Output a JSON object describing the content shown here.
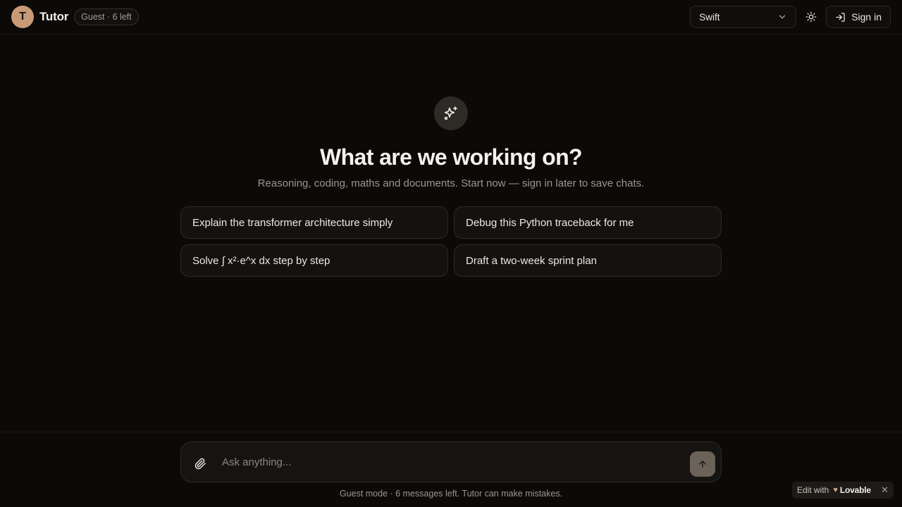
{
  "header": {
    "avatar_letter": "T",
    "app_name": "Tutor",
    "guest_badge": "Guest · 6 left",
    "model_selected": "Swift",
    "signin_label": "Sign in"
  },
  "hero": {
    "title": "What are we working on?",
    "subtitle": "Reasoning, coding, maths and documents. Start now — sign in later to save chats."
  },
  "suggestions": [
    "Explain the transformer architecture simply",
    "Debug this Python traceback for me",
    "Solve ∫ x²·e^x dx step by step",
    "Draft a two-week sprint plan"
  ],
  "composer": {
    "placeholder": "Ask anything...",
    "footnote": "Guest mode · 6 messages left. Tutor can make mistakes."
  },
  "badge": {
    "edit_with": "Edit with",
    "brand": "Lovable",
    "close": "✕"
  },
  "icons": {
    "sparkle": "sparkle-icon",
    "sun": "sun-icon",
    "signin": "sign-in-icon",
    "chevron": "chevron-down-icon",
    "paperclip": "paperclip-icon",
    "arrow_up": "arrow-up-icon"
  },
  "colors": {
    "background": "#0b0a09",
    "avatar": "#c99a78",
    "send_button": "#6b625a"
  }
}
